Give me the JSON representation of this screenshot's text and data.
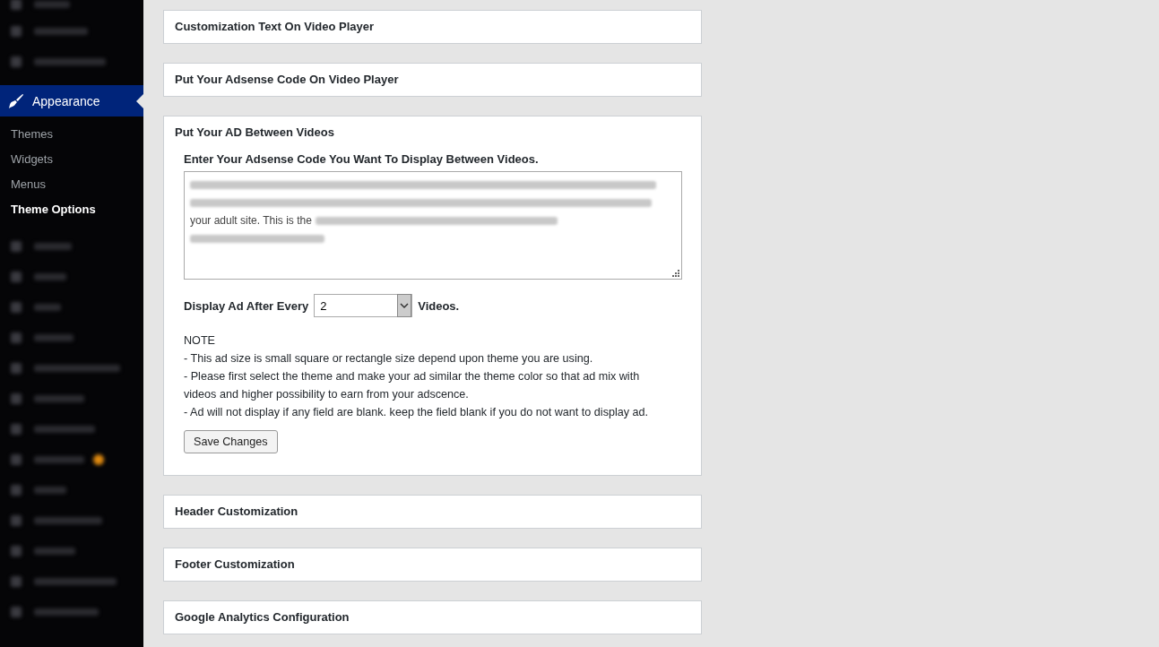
{
  "sidebar": {
    "active_menu": {
      "label": "Appearance",
      "submenu": [
        {
          "label": "Themes",
          "selected": false
        },
        {
          "label": "Widgets",
          "selected": false
        },
        {
          "label": "Menus",
          "selected": false
        },
        {
          "label": "Theme Options",
          "selected": true
        }
      ]
    }
  },
  "panels": [
    {
      "title": "Customization Text On Video Player",
      "expanded": false
    },
    {
      "title": "Put Your Adsense Code On Video Player",
      "expanded": false
    },
    {
      "title": "Put Your AD Between Videos",
      "expanded": true,
      "code_label": "Enter Your Adsense Code You Want To Display Between Videos.",
      "code_readable_fragment": "your adult site. This is the",
      "every_label": "Display Ad After Every",
      "every_value": "2",
      "every_suffix": "Videos.",
      "note_title": "NOTE",
      "notes": [
        "- This ad size is small square or rectangle size depend upon theme you are using.",
        "- Please first select the theme and make your ad similar the theme color so that ad mix with videos and higher possibility to earn from your adscence.",
        "- Ad will not display if any field are blank. keep the field blank if you do not want to display ad."
      ],
      "save_button": "Save Changes"
    },
    {
      "title": "Header Customization",
      "expanded": false
    },
    {
      "title": "Footer Customization",
      "expanded": false
    },
    {
      "title": "Google Analytics Configuration",
      "expanded": false
    }
  ]
}
